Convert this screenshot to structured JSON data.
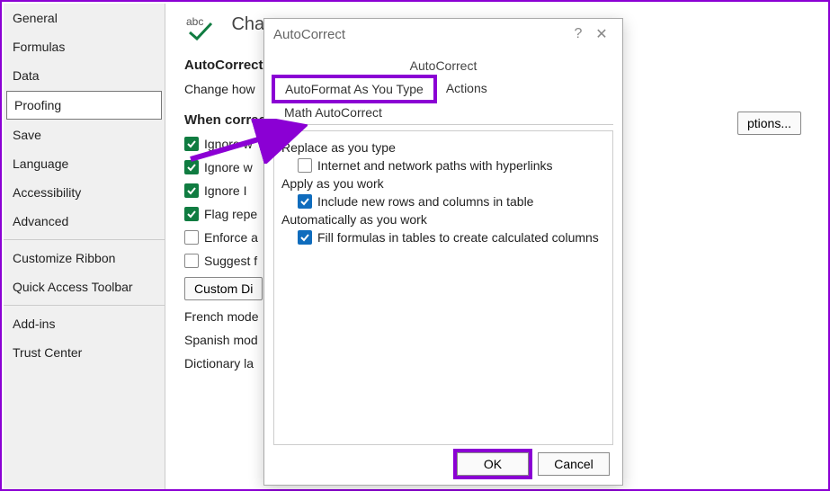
{
  "sidebar": {
    "items": [
      {
        "label": "General"
      },
      {
        "label": "Formulas"
      },
      {
        "label": "Data"
      },
      {
        "label": "Proofing",
        "selected": true
      },
      {
        "label": "Save"
      },
      {
        "label": "Language"
      },
      {
        "label": "Accessibility"
      },
      {
        "label": "Advanced"
      },
      {
        "label": "Customize Ribbon"
      },
      {
        "label": "Quick Access Toolbar"
      },
      {
        "label": "Add-ins"
      },
      {
        "label": "Trust Center"
      }
    ]
  },
  "main": {
    "header_title": "Chan",
    "section1": "AutoCorrect o",
    "change_how": "Change how",
    "options_btn": "ptions...",
    "section2": "When correc",
    "opts": [
      {
        "label": "Ignore w",
        "checked": true
      },
      {
        "label": "Ignore w",
        "checked": true
      },
      {
        "label": "Ignore I",
        "checked": true
      },
      {
        "label": "Flag repe",
        "checked": true
      },
      {
        "label": "Enforce a",
        "checked": false
      },
      {
        "label": "Suggest f",
        "checked": false
      }
    ],
    "custom_btn": "Custom Di",
    "tail": [
      "French mode",
      "Spanish mod",
      "Dictionary la"
    ]
  },
  "dialog": {
    "title": "AutoCorrect",
    "help": "?",
    "close": "✕",
    "tab_top": "AutoCorrect",
    "tabs": [
      {
        "label": "AutoFormat As You Type",
        "active": true,
        "highlight": true
      },
      {
        "label": "Actions"
      },
      {
        "label": "Math AutoCorrect"
      }
    ],
    "groups": [
      {
        "title": "Replace as you type",
        "options": [
          {
            "label": "Internet and network paths with hyperlinks",
            "checked": false
          }
        ]
      },
      {
        "title": "Apply as you work",
        "options": [
          {
            "label": "Include new rows and columns in table",
            "checked": true
          }
        ]
      },
      {
        "title": "Automatically as you work",
        "options": [
          {
            "label": "Fill formulas in tables to create calculated columns",
            "checked": true
          }
        ]
      }
    ],
    "ok": "OK",
    "cancel": "Cancel"
  }
}
